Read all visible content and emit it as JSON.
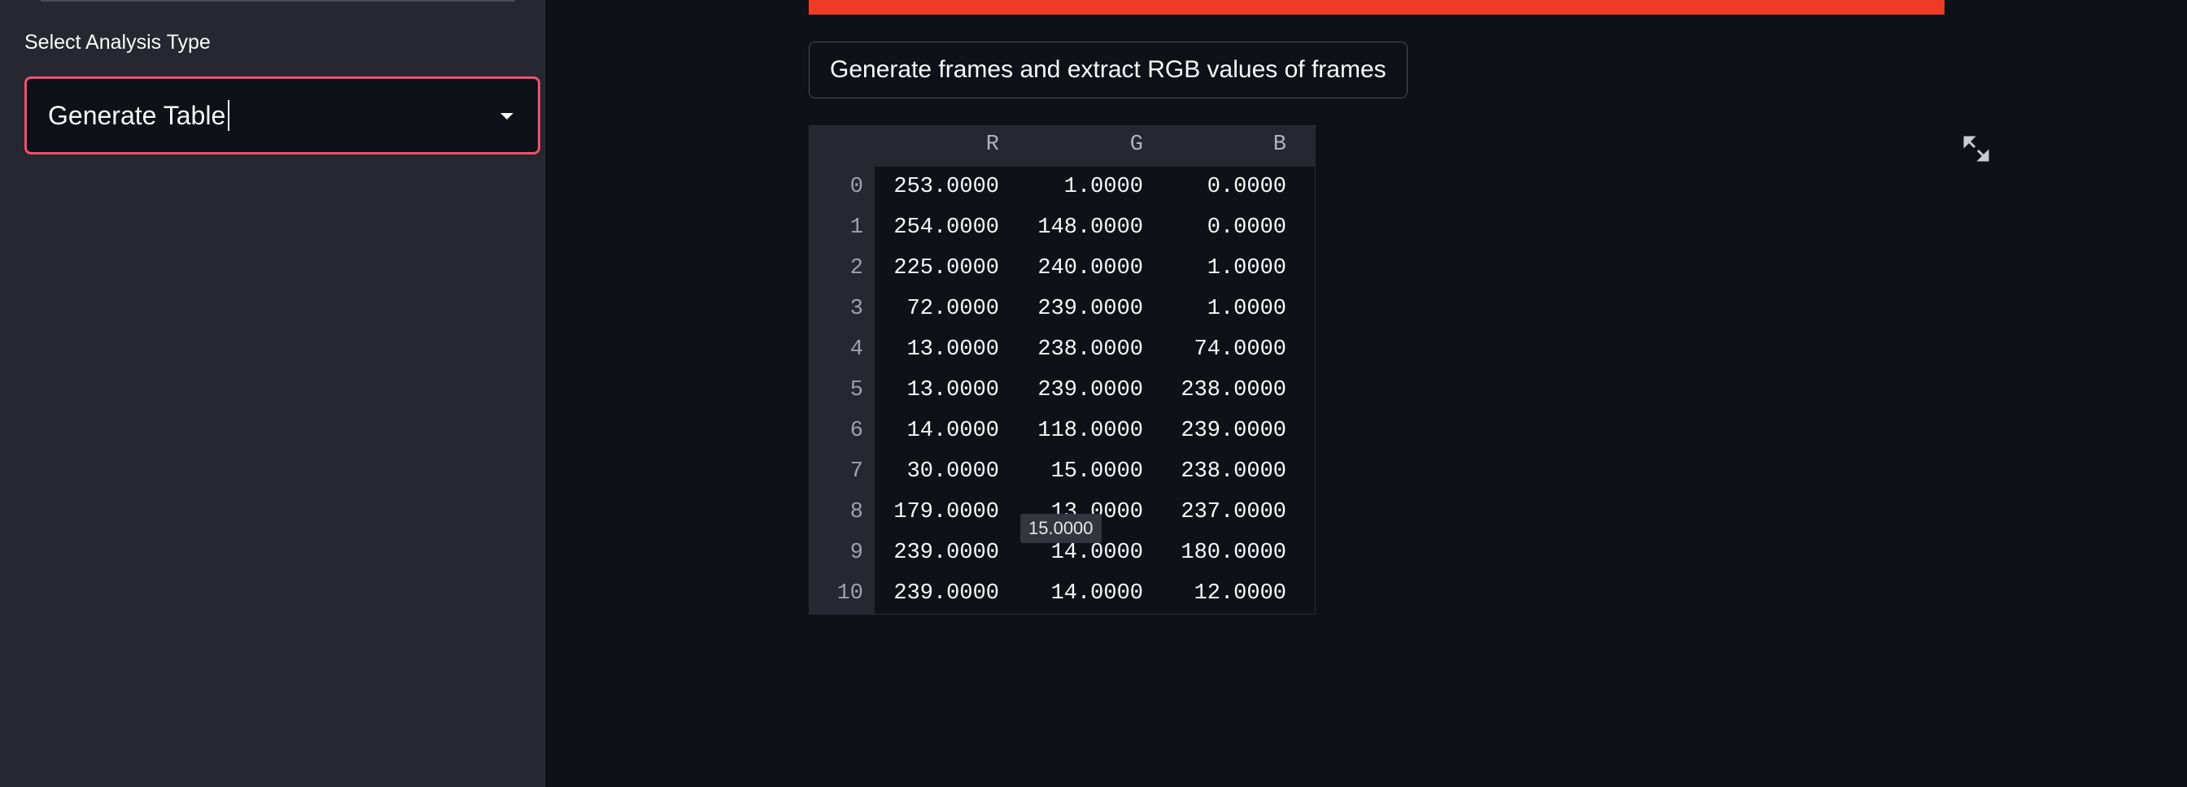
{
  "sidebar": {
    "select_label": "Select Analysis Type",
    "select_value": "Generate Table"
  },
  "main": {
    "button_label": "Generate frames and extract RGB values of frames",
    "table": {
      "columns": [
        "R",
        "G",
        "B"
      ],
      "rows": [
        {
          "index": "0",
          "r": "253.0000",
          "g": "1.0000",
          "b": "0.0000"
        },
        {
          "index": "1",
          "r": "254.0000",
          "g": "148.0000",
          "b": "0.0000"
        },
        {
          "index": "2",
          "r": "225.0000",
          "g": "240.0000",
          "b": "1.0000"
        },
        {
          "index": "3",
          "r": "72.0000",
          "g": "239.0000",
          "b": "1.0000"
        },
        {
          "index": "4",
          "r": "13.0000",
          "g": "238.0000",
          "b": "74.0000"
        },
        {
          "index": "5",
          "r": "13.0000",
          "g": "239.0000",
          "b": "238.0000"
        },
        {
          "index": "6",
          "r": "14.0000",
          "g": "118.0000",
          "b": "239.0000"
        },
        {
          "index": "7",
          "r": "30.0000",
          "g": "15.0000",
          "b": "238.0000"
        },
        {
          "index": "8",
          "r": "179.0000",
          "g": "13.0000",
          "b": "237.0000"
        },
        {
          "index": "9",
          "r": "239.0000",
          "g": "14.0000",
          "b": "180.0000"
        },
        {
          "index": "10",
          "r": "239.0000",
          "g": "14.0000",
          "b": "12.0000"
        }
      ],
      "tooltip": "15.0000"
    }
  },
  "colors": {
    "accent": "#ef3a25",
    "select_border": "#f0506e",
    "background": "#0e1117",
    "sidebar": "#262730"
  },
  "icons": [
    "chevron-down-icon",
    "expand-icon"
  ]
}
